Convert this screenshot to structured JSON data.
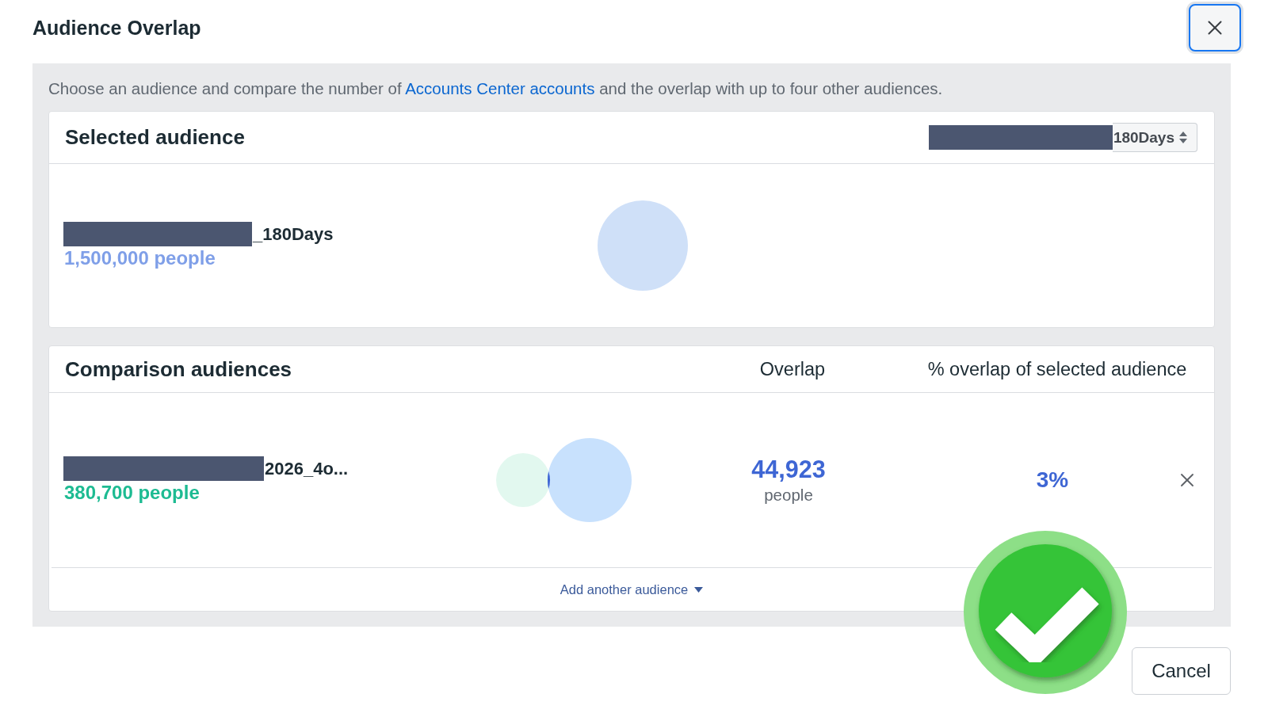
{
  "dialog": {
    "title": "Audience Overlap"
  },
  "description": {
    "before": "Choose an audience and compare the number of ",
    "link": "Accounts Center accounts",
    "after": " and the overlap with up to four other audiences."
  },
  "selected": {
    "title": "Selected audience",
    "dropdown": {
      "value": "180Days",
      "redacted": true
    },
    "audience": {
      "name": "_180Days",
      "redacted": true,
      "size": "1,500,000 people"
    }
  },
  "comparison": {
    "title": "Comparison audiences",
    "columns": [
      "Overlap",
      "% overlap of selected audience"
    ],
    "rows": [
      {
        "name": "2026_4o...",
        "redacted": true,
        "size": "380,700 people",
        "overlap": "44,923",
        "overlap_unit": "people",
        "percent": "3%"
      }
    ],
    "add_link": "Add another audience"
  },
  "footer": {
    "buttons": [
      "Cancel"
    ]
  },
  "overlay": {
    "kind": "checkmark"
  }
}
